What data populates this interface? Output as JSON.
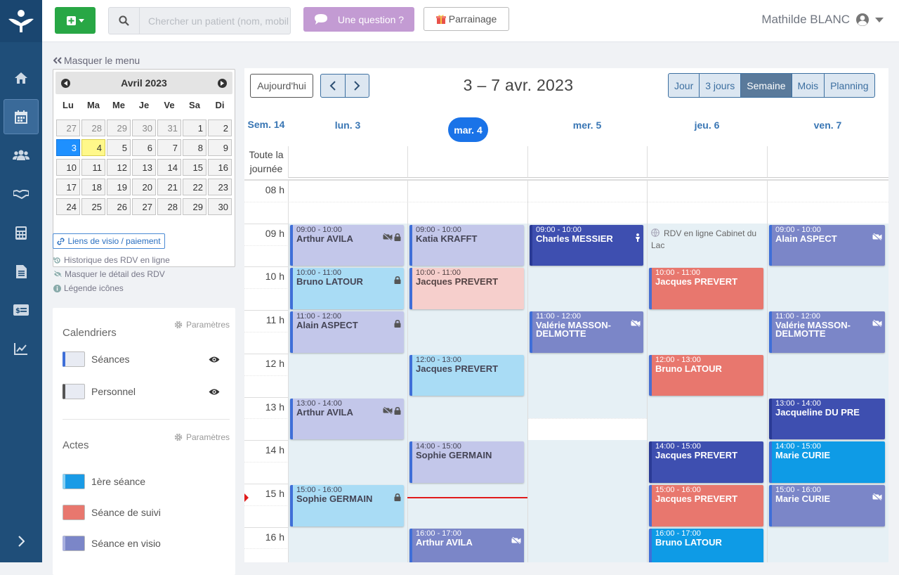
{
  "topbar": {
    "search_placeholder": "Chercher un patient (nom, mobile...)",
    "question_label": "Une question ?",
    "referral_label": "Parrainage",
    "user_name": "Mathilde BLANC"
  },
  "sidebar": {
    "hide_menu_label": "Masquer le menu",
    "minical": {
      "title": "Avril 2023",
      "dow": [
        "Lu",
        "Ma",
        "Me",
        "Je",
        "Ve",
        "Sa",
        "Di"
      ],
      "weeks": [
        [
          "27",
          "28",
          "29",
          "30",
          "31",
          "1",
          "2"
        ],
        [
          "3",
          "4",
          "5",
          "6",
          "7",
          "8",
          "9"
        ],
        [
          "10",
          "11",
          "12",
          "13",
          "14",
          "15",
          "16"
        ],
        [
          "17",
          "18",
          "19",
          "20",
          "21",
          "22",
          "23"
        ],
        [
          "24",
          "25",
          "26",
          "27",
          "28",
          "29",
          "30"
        ]
      ]
    },
    "video_links_label": "Liens de visio / paiement",
    "history_label": "Historique des RDV en ligne",
    "hide_details_label": "Masquer le détail des RDV",
    "legend_label": "Légende icônes",
    "calendars_title": "Calendriers",
    "params_label": "Paramètres",
    "calendars": [
      {
        "label": "Séances",
        "color": "#3f6fd8"
      },
      {
        "label": "Personnel",
        "color": "#555555"
      }
    ],
    "acts_title": "Actes",
    "acts": [
      {
        "label": "1ère séance",
        "color": "#1a9be6"
      },
      {
        "label": "Séance de suivi",
        "color": "#e8776e"
      },
      {
        "label": "Séance en visio",
        "color": "#7b86c8"
      }
    ]
  },
  "calendar": {
    "today_label": "Aujourd'hui",
    "title": "3 – 7 avr. 2023",
    "views": [
      "Jour",
      "3 jours",
      "Semaine",
      "Mois",
      "Planning"
    ],
    "active_view": "Semaine",
    "week_label": "Sem. 14",
    "allday_label": "Toute la journée",
    "days": [
      "lun. 3",
      "mar. 4",
      "mer. 5",
      "jeu. 6",
      "ven. 7"
    ],
    "hours": [
      "08 h",
      "09 h",
      "10 h",
      "11 h",
      "12 h",
      "13 h",
      "14 h",
      "15 h",
      "16 h"
    ],
    "online_slot_label": "RDV en ligne Cabinet du Lac",
    "now_time": "15:20",
    "events": [
      {
        "day": 0,
        "start": 9,
        "end": 10,
        "time": "09:00 - 10:00",
        "name": "Arthur AVILA",
        "kind": "visio-light",
        "icons": [
          "video-off-icon",
          "lock-icon"
        ]
      },
      {
        "day": 0,
        "start": 10,
        "end": 11,
        "time": "10:00 - 11:00",
        "name": "Bruno LATOUR",
        "kind": "first-light",
        "icons": [
          "lock-icon"
        ]
      },
      {
        "day": 0,
        "start": 11,
        "end": 12,
        "time": "11:00 - 12:00",
        "name": "Alain ASPECT",
        "kind": "visio-light",
        "icons": [
          "lock-icon"
        ]
      },
      {
        "day": 0,
        "start": 13,
        "end": 14,
        "time": "13:00 - 14:00",
        "name": "Arthur AVILA",
        "kind": "visio-light",
        "icons": [
          "video-off-icon",
          "lock-icon"
        ]
      },
      {
        "day": 0,
        "start": 15,
        "end": 16,
        "time": "15:00 - 16:00",
        "name": "Sophie GERMAIN",
        "kind": "first-light",
        "icons": [
          "lock-icon"
        ]
      },
      {
        "day": 1,
        "start": 9,
        "end": 10,
        "time": "09:00 - 10:00",
        "name": "Katia KRAFFT",
        "kind": "visio-light",
        "icons": []
      },
      {
        "day": 1,
        "start": 10,
        "end": 11,
        "time": "10:00 - 11:00",
        "name": "Jacques PREVERT",
        "kind": "follow-light",
        "icons": []
      },
      {
        "day": 1,
        "start": 12,
        "end": 13,
        "time": "12:00 - 13:00",
        "name": "Jacques PREVERT",
        "kind": "first-light",
        "icons": []
      },
      {
        "day": 1,
        "start": 14,
        "end": 15,
        "time": "14:00 - 15:00",
        "name": "Sophie GERMAIN",
        "kind": "visio-light",
        "icons": []
      },
      {
        "day": 1,
        "start": 16,
        "end": 17,
        "time": "16:00 - 17:00",
        "name": "Arthur AVILA",
        "kind": "visio",
        "icons": [
          "video-off-icon"
        ]
      },
      {
        "day": 2,
        "start": 9,
        "end": 10,
        "time": "09:00 - 10:00",
        "name": "Charles MESSIER",
        "kind": "dark",
        "icons": [
          "person-icon"
        ]
      },
      {
        "day": 2,
        "start": 11,
        "end": 12,
        "time": "11:00 - 12:00",
        "name": "Valérie MASSON-DELMOTTE",
        "kind": "visio",
        "icons": [
          "video-off-icon"
        ]
      },
      {
        "day": 3,
        "start": 10,
        "end": 11,
        "time": "10:00 - 11:00",
        "name": "Jacques PREVERT",
        "kind": "follow",
        "icons": []
      },
      {
        "day": 3,
        "start": 12,
        "end": 13,
        "time": "12:00 - 13:00",
        "name": "Bruno LATOUR",
        "kind": "follow",
        "icons": []
      },
      {
        "day": 3,
        "start": 14,
        "end": 15,
        "time": "14:00 - 15:00",
        "name": "Jacques PREVERT",
        "kind": "dark",
        "icons": []
      },
      {
        "day": 3,
        "start": 15,
        "end": 16,
        "time": "15:00 - 16:00",
        "name": "Jacques PREVERT",
        "kind": "follow",
        "icons": []
      },
      {
        "day": 3,
        "start": 16,
        "end": 17,
        "time": "16:00 - 17:00",
        "name": "Bruno LATOUR",
        "kind": "first",
        "icons": []
      },
      {
        "day": 4,
        "start": 9,
        "end": 10,
        "time": "09:00 - 10:00",
        "name": "Alain ASPECT",
        "kind": "visio",
        "icons": [
          "video-off-icon"
        ]
      },
      {
        "day": 4,
        "start": 11,
        "end": 12,
        "time": "11:00 - 12:00",
        "name": "Valérie MASSON-DELMOTTE",
        "kind": "visio",
        "icons": [
          "video-off-icon"
        ]
      },
      {
        "day": 4,
        "start": 13,
        "end": 14,
        "time": "13:00 - 14:00",
        "name": "Jacqueline DU PRE",
        "kind": "dark",
        "icons": []
      },
      {
        "day": 4,
        "start": 14,
        "end": 15,
        "time": "14:00 - 15:00",
        "name": "Marie CURIE",
        "kind": "first",
        "icons": []
      },
      {
        "day": 4,
        "start": 15,
        "end": 16,
        "time": "15:00 - 16:00",
        "name": "Marie CURIE",
        "kind": "visio",
        "icons": [
          "video-off-icon"
        ]
      }
    ]
  },
  "colors": {
    "first-light": "#a9dcf5",
    "visio-light": "#c3c7ea",
    "follow-light": "#f6cfcc",
    "visio": "#7b86c8",
    "follow": "#e8776e",
    "first": "#0e9be6",
    "dark": "#3e4fb0",
    "available": "#e6f0f5"
  }
}
